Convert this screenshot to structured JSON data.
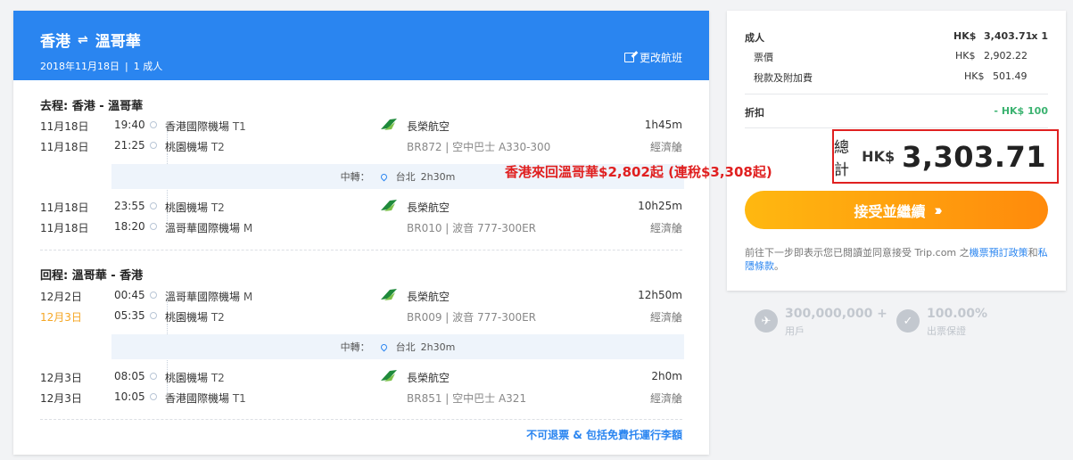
{
  "header": {
    "origin": "香港",
    "swap_symbol": "⇌",
    "destination": "溫哥華",
    "date": "2018年11月18日",
    "separator": "|",
    "pax": "1 成人",
    "change_label": "更改航班"
  },
  "outbound": {
    "title": "去程: 香港 - 溫哥華",
    "leg1": {
      "dep_date": "11月18日",
      "dep_time": "19:40",
      "dep_airport": "香港國際機場",
      "dep_term": "T1",
      "arr_date": "11月18日",
      "arr_time": "21:25",
      "arr_airport": "桃園機場",
      "arr_term": "T2",
      "airline": "長榮航空",
      "flight": "BR872 | 空中巴士 A330-300",
      "duration": "1h45m",
      "cabin": "經濟艙"
    },
    "transfer": {
      "label": "中轉：",
      "city": "台北",
      "wait": "2h30m"
    },
    "leg2": {
      "dep_date": "11月18日",
      "dep_time": "23:55",
      "dep_airport": "桃園機場",
      "dep_term": "T2",
      "arr_date": "11月18日",
      "arr_time": "18:20",
      "arr_airport": "溫哥華國際機場",
      "arr_term": "M",
      "airline": "長榮航空",
      "flight": "BR010 | 波音 777-300ER",
      "duration": "10h25m",
      "cabin": "經濟艙"
    }
  },
  "inbound": {
    "title": "回程: 溫哥華 - 香港",
    "leg1": {
      "dep_date": "12月2日",
      "dep_time": "00:45",
      "dep_airport": "溫哥華國際機場",
      "dep_term": "M",
      "arr_date": "12月3日",
      "arr_time": "05:35",
      "arr_airport": "桃園機場",
      "arr_term": "T2",
      "airline": "長榮航空",
      "flight": "BR009 | 波音 777-300ER",
      "duration": "12h50m",
      "cabin": "經濟艙"
    },
    "transfer": {
      "label": "中轉：",
      "city": "台北",
      "wait": "2h30m"
    },
    "leg2": {
      "dep_date": "12月3日",
      "dep_time": "08:05",
      "dep_airport": "桃園機場",
      "dep_term": "T2",
      "arr_date": "12月3日",
      "arr_time": "10:05",
      "arr_airport": "香港國際機場",
      "arr_term": "T1",
      "airline": "長榮航空",
      "flight": "BR851 | 空中巴士 A321",
      "duration": "2h0m",
      "cabin": "經濟艙"
    }
  },
  "refund_note": "不可退票 & 包括免費托運行李額",
  "price": {
    "adult_label": "成人",
    "adult_cur": "HK$",
    "adult_amount": "3,403.71",
    "adult_qty": "x 1",
    "fare_label": "票價",
    "fare_cur": "HK$",
    "fare_amount": "2,902.22",
    "tax_label": "稅款及附加費",
    "tax_cur": "HK$",
    "tax_amount": "501.49",
    "discount_label": "折扣",
    "discount_value": "- HK$  100",
    "total_label": "總計",
    "total_cur": "HK$",
    "total_amount": "3,303.71"
  },
  "accept_label": "接受並繼續",
  "terms": {
    "text": "前往下一步即表示您已閱讀並同意接受 Trip.com 之",
    "link1": "機票預訂政策",
    "and": "和",
    "link2": "私隱條款",
    "end": "。"
  },
  "badges": [
    {
      "big": "300,000,000 +",
      "small": "用戶"
    },
    {
      "big": "100.00%",
      "small": "出票保證"
    }
  ],
  "promo_text": "香港來回溫哥華$2,802起 (連稅$3,308起)",
  "colors": {
    "brand_blue": "#2a85f0",
    "accent_orange": "#ff8a0c",
    "highlight_red": "#e02020",
    "date_warn": "#f5a623"
  }
}
